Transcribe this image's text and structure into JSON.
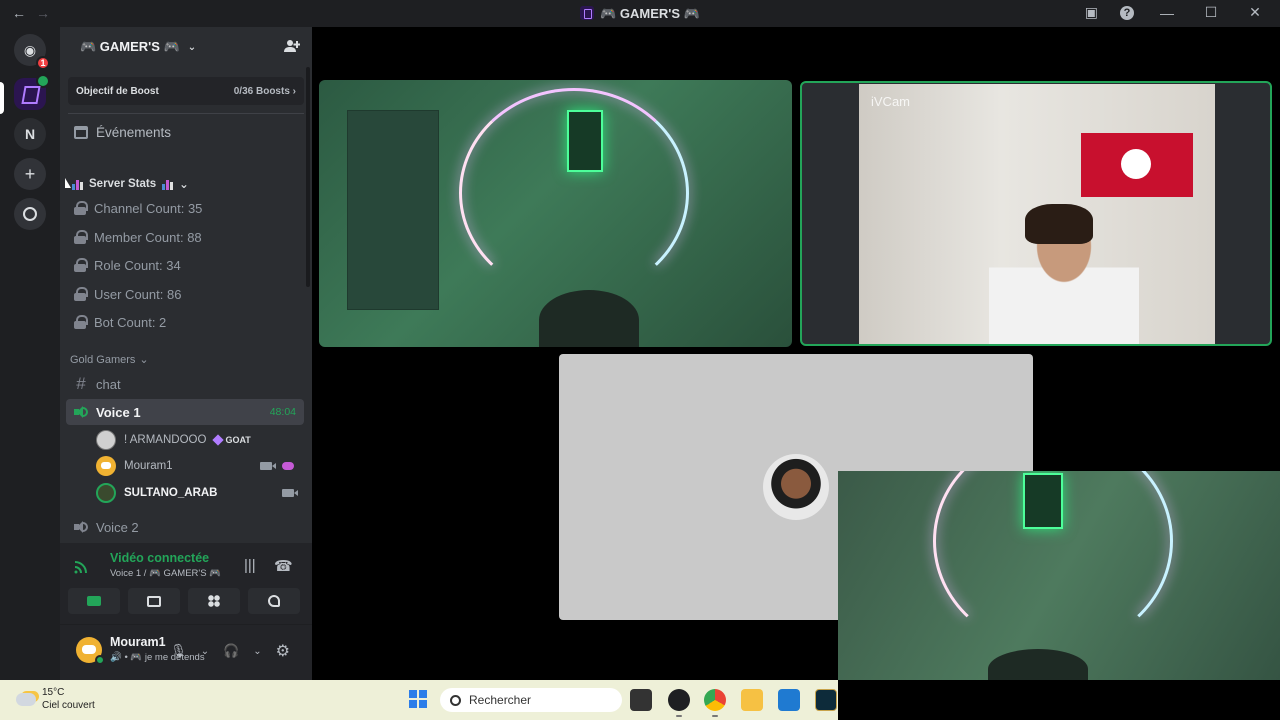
{
  "window": {
    "title": "🎮 GAMER'S 🎮"
  },
  "servers": {
    "home_badge": "1",
    "n_label": "N",
    "add_label": "+"
  },
  "guild": {
    "name": "🎮 GAMER'S 🎮"
  },
  "boost": {
    "label": "Objectif de Boost",
    "progress": "0/36 Boosts ›"
  },
  "events": {
    "label": "Événements"
  },
  "categories": {
    "stats": "Server Stats",
    "gold": "Gold Gamers"
  },
  "stat_channels": [
    "Channel Count: 35",
    "Member Count: 88",
    "Role Count: 34",
    "User Count: 86",
    "Bot Count: 2"
  ],
  "text_channels": {
    "chat": "chat"
  },
  "voice_channels": {
    "voice1": "Voice 1",
    "voice1_timer": "48:04",
    "voice2": "Voice 2"
  },
  "members": [
    {
      "name": "! ARMANDOOO",
      "tag": "GOAT"
    },
    {
      "name": "Mouram1"
    },
    {
      "name": "SULTANO_ARAB"
    }
  ],
  "voice_panel": {
    "status": "Vidéo connectée",
    "location": "Voice 1 / 🎮 GAMER'S 🎮"
  },
  "user": {
    "name": "Mouram1",
    "status": "🔊 • 🎮 je me détends"
  },
  "video": {
    "cam_label": "iVCam"
  },
  "taskbar": {
    "temp": "15°C",
    "condition": "Ciel couvert",
    "search": "Rechercher"
  },
  "colors": {
    "connected_green": "#23a559",
    "sidebar_bg": "#2b2d31",
    "rail_bg": "#1e1f22",
    "active_channel_bg": "#404249"
  }
}
